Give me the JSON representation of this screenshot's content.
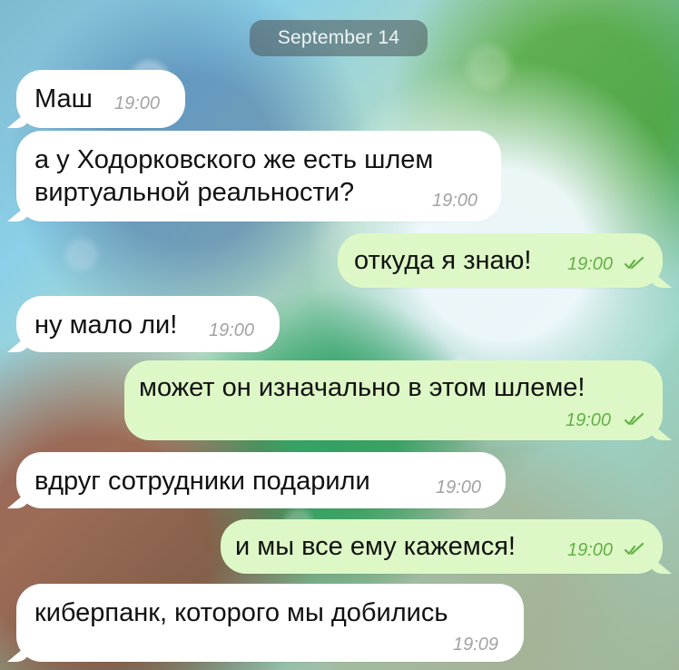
{
  "colors": {
    "incoming_bubble": "#ffffff",
    "outgoing_bubble": "#ddf8c6",
    "incoming_time": "#a3a3a3",
    "outgoing_time": "#63b047"
  },
  "chat": {
    "date_separator": "September 14",
    "messages": [
      {
        "direction": "incoming",
        "text": "Маш",
        "time": "19:00"
      },
      {
        "direction": "incoming",
        "text": "а у Ходорковского же есть шлем\nвиртуальной реальности?",
        "time": "19:00"
      },
      {
        "direction": "outgoing",
        "text": "откуда я знаю!",
        "time": "19:00",
        "status_icon": "double-check-icon"
      },
      {
        "direction": "incoming",
        "text": "ну мало ли!",
        "time": "19:00"
      },
      {
        "direction": "outgoing",
        "text": "может он изначально в этом шлеме!",
        "time": "19:00",
        "status_icon": "double-check-icon"
      },
      {
        "direction": "incoming",
        "text": "вдруг сотрудники подарили",
        "time": "19:00"
      },
      {
        "direction": "outgoing",
        "text": "и мы все ему кажемся!",
        "time": "19:00",
        "status_icon": "double-check-icon"
      },
      {
        "direction": "incoming",
        "text": "киберпанк, которого мы добились",
        "time": "19:09"
      }
    ]
  }
}
